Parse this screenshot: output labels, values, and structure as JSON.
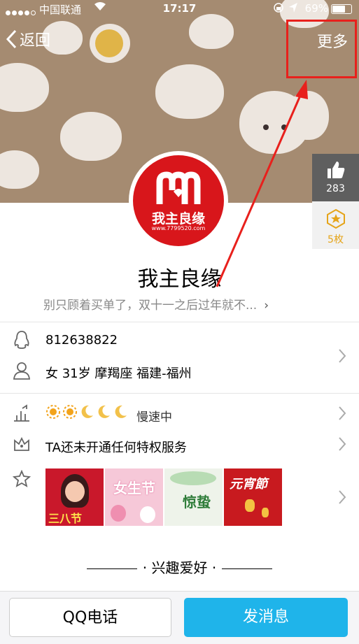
{
  "status_bar": {
    "carrier": "中国联通",
    "time": "17:17",
    "battery": "69%"
  },
  "nav": {
    "back_label": "返回",
    "more_label": "更多"
  },
  "side": {
    "like_count": "283",
    "medal_label": "5枚"
  },
  "profile": {
    "avatar_text": "我主良缘",
    "avatar_url": "www.7799520.com",
    "name": "我主良缘",
    "signature": "别只顾着买单了，双十一之后过年就不...",
    "qq_number": "812638822",
    "info": "女 31岁 摩羯座 福建-福州",
    "level_status": "慢速中",
    "privilege": "TA还未开通任何特权服务"
  },
  "photos": [
    {
      "text": "三八节",
      "bg": "#c9182b"
    },
    {
      "text": "女生节",
      "bg": "#f6c8d8"
    },
    {
      "text": "惊蛰",
      "bg": "#eef3ea"
    },
    {
      "text": "元宵節",
      "bg": "#c81a1f"
    }
  ],
  "hobby_title": "兴趣爱好",
  "footer": {
    "call_label": "QQ电话",
    "message_label": "发消息"
  },
  "colors": {
    "header_bg": "#a58b71",
    "accent_blue": "#1fb4ea",
    "annotation_red": "#e8201c"
  }
}
